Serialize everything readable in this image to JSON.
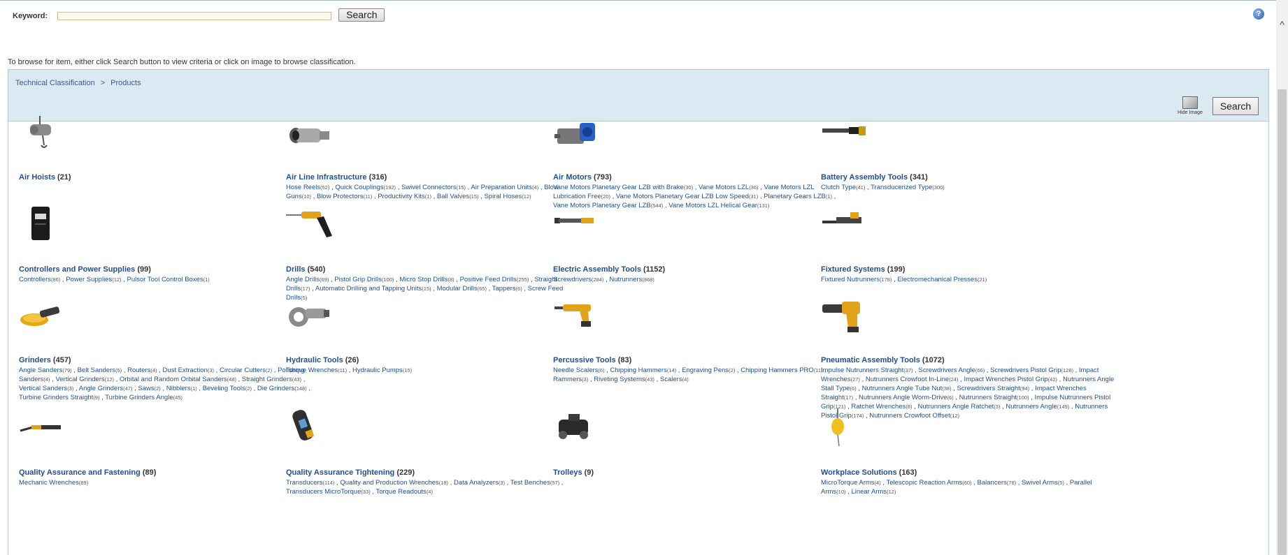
{
  "search": {
    "label": "Keyword:",
    "value": "",
    "button": "Search"
  },
  "instruction": "To browse for item, either click Search button to view criteria or click on image to browse classification.",
  "breadcrumb": {
    "root": "Technical Classification",
    "separator": ">",
    "current": "Products"
  },
  "panel": {
    "hide_image_label": "Hide Image",
    "search_button": "Search"
  },
  "categories": [
    {
      "name": "Air Hoists",
      "count": "(21)",
      "items": []
    },
    {
      "name": "Air Line Infrastructure",
      "count": "(316)",
      "items": [
        [
          "Hose Reels",
          "(52)"
        ],
        [
          "Quick Couplings",
          "(192)"
        ],
        [
          "Swivel Connectors",
          "(15)"
        ],
        [
          "Air Preparation Units",
          "(4)"
        ],
        [
          "Blow Guns",
          "(10)"
        ],
        [
          "Blow Protectors",
          "(11)"
        ],
        [
          "Productivity Kits",
          "(1)"
        ],
        [
          "Ball Valves",
          "(15)"
        ],
        [
          "Spiral Hoses",
          "(12)"
        ]
      ]
    },
    {
      "name": "Air Motors",
      "count": "(793)",
      "items": [
        [
          "Vane Motors Planetary Gear LZB with Brake",
          "(30)"
        ],
        [
          "Vane Motors LZL",
          "(36)"
        ],
        [
          "Vane Motors LZL Lubrication Free",
          "(20)"
        ],
        [
          "Vane Motors Planetary Gear LZB Low Speed",
          "(31)"
        ],
        [
          "Planetary Gears LZB",
          "(1)"
        ],
        [
          "Vane Motors Planetary Gear LZB",
          "(544)"
        ],
        [
          "Vane Motors LZL Helical Gear",
          "(131)"
        ]
      ]
    },
    {
      "name": "Battery Assembly Tools",
      "count": "(341)",
      "items": [
        [
          "Clutch Type",
          "(41)"
        ],
        [
          "Transducerized Type",
          "(300)"
        ]
      ]
    },
    {
      "name": "Controllers and Power Supplies",
      "count": "(99)",
      "items": [
        [
          "Controllers",
          "(86)"
        ],
        [
          "Power Supplies",
          "(12)"
        ],
        [
          "Pulsor Tool Control Boxes",
          "(1)"
        ]
      ]
    },
    {
      "name": "Drills",
      "count": "(540)",
      "items": [
        [
          "Angle Drills",
          "(69)"
        ],
        [
          "Pistol Grip Drills",
          "(100)"
        ],
        [
          "Micro Stop Drills",
          "(8)"
        ],
        [
          "Positive Feed Drills",
          "(255)"
        ],
        [
          "Straight Drills",
          "(17)"
        ],
        [
          "Automatic Drilling and Tapping Units",
          "(15)"
        ],
        [
          "Modular Drills",
          "(65)"
        ],
        [
          "Tappers",
          "(6)"
        ],
        [
          "Screw Feed Drills",
          "(5)"
        ]
      ]
    },
    {
      "name": "Electric Assembly Tools",
      "count": "(1152)",
      "items": [
        [
          "Screwdrivers",
          "(284)"
        ],
        [
          "Nutrunners",
          "(868)"
        ]
      ]
    },
    {
      "name": "Fixtured Systems",
      "count": "(199)",
      "items": [
        [
          "Fixtured Nutrunners",
          "(178)"
        ],
        [
          "Electromechanical Presses",
          "(21)"
        ]
      ]
    },
    {
      "name": "Grinders",
      "count": "(457)",
      "items": [
        [
          "Angle Sanders",
          "(79)"
        ],
        [
          "Belt Sanders",
          "(5)"
        ],
        [
          "Routers",
          "(4)"
        ],
        [
          "Dust Extraction",
          "(3)"
        ],
        [
          "Circular Cutters",
          "(2)"
        ],
        [
          "Polishing Sanders",
          "(4)"
        ],
        [
          "Vertical Grinders",
          "(12)"
        ],
        [
          "Orbital and Random Orbital Sanders",
          "(48)"
        ],
        [
          "Straight Grinders",
          "(43)"
        ],
        [
          "Vertical Sanders",
          "(3)"
        ],
        [
          "Angle Grinders",
          "(47)"
        ],
        [
          "Saws",
          "(2)"
        ],
        [
          "Nibblers",
          "(1)"
        ],
        [
          "Beveling Tools",
          "(2)"
        ],
        [
          "Die Grinders",
          "(148)"
        ],
        [
          "Turbine Grinders Straight",
          "(9)"
        ],
        [
          "Turbine Grinders Angle",
          "(45)"
        ]
      ]
    },
    {
      "name": "Hydraulic Tools",
      "count": "(26)",
      "items": [
        [
          "Torque Wrenches",
          "(11)"
        ],
        [
          "Hydraulic Pumps",
          "(15)"
        ]
      ]
    },
    {
      "name": "Percussive Tools",
      "count": "(83)",
      "items": [
        [
          "Needle Scalers",
          "(6)"
        ],
        [
          "Chipping Hammers",
          "(14)"
        ],
        [
          "Engraving Pens",
          "(2)"
        ],
        [
          "Chipping Hammers PRO",
          "(11)"
        ],
        [
          "Rammers",
          "(3)"
        ],
        [
          "Riveting Systems",
          "(43)"
        ],
        [
          "Scalers",
          "(4)"
        ]
      ]
    },
    {
      "name": "Pneumatic Assembly Tools",
      "count": "(1072)",
      "items": [
        [
          "Impulse Nutrunners Straight",
          "(37)"
        ],
        [
          "Screwdrivers Angle",
          "(66)"
        ],
        [
          "Screwdrivers Pistol Grip",
          "(128)"
        ],
        [
          "Impact Wrenches",
          "(27)"
        ],
        [
          "Nutrunners Crowfoot In-Line",
          "(24)"
        ],
        [
          "Impact Wrenches Pistol Grip",
          "(42)"
        ],
        [
          "Nutrunners Angle Stall Type",
          "(6)"
        ],
        [
          "Nutrunners Angle Tube Nut",
          "(38)"
        ],
        [
          "Screwdrivers Straight",
          "(94)"
        ],
        [
          "Impact Wrenches Straight",
          "(17)"
        ],
        [
          "Nutrunners Angle Worm-Drive",
          "(6)"
        ],
        [
          "Nutrunners Straight",
          "(100)"
        ],
        [
          "Impulse Nutrunners Pistol Grip",
          "(121)"
        ],
        [
          "Ratchet Wrenches",
          "(8)"
        ],
        [
          "Nutrunners Angle Ratchet",
          "(3)"
        ],
        [
          "Nutrunners Angle",
          "(149)"
        ],
        [
          "Nutrunners Pistol Grip",
          "(174)"
        ],
        [
          "Nutrunners Crowfoot Offset",
          "(12)"
        ]
      ]
    },
    {
      "name": "Quality Assurance and Fastening",
      "count": "(89)",
      "items": [
        [
          "Mechanic Wrenches",
          "(89)"
        ]
      ]
    },
    {
      "name": "Quality Assurance Tightening",
      "count": "(229)",
      "items": [
        [
          "Transducers",
          "(114)"
        ],
        [
          "Quality and Production Wrenches",
          "(18)"
        ],
        [
          "Data Analyzers",
          "(3)"
        ],
        [
          "Test Benches",
          "(57)"
        ],
        [
          "Transducers MicroTorque",
          "(33)"
        ],
        [
          "Torque Readouts",
          "(4)"
        ]
      ]
    },
    {
      "name": "Trolleys",
      "count": "(9)",
      "items": []
    },
    {
      "name": "Workplace Solutions",
      "count": "(163)",
      "items": [
        [
          "MicroTorque Arms",
          "(4)"
        ],
        [
          "Telescopic Reaction Arms",
          "(60)"
        ],
        [
          "Balancers",
          "(78)"
        ],
        [
          "Swivel Arms",
          "(5)"
        ],
        [
          "Parallel Arms",
          "(10)"
        ],
        [
          "Linear Arms",
          "(12)"
        ]
      ]
    }
  ],
  "icons": [
    "air-hoist-icon",
    "air-line-coupling-icon",
    "air-motor-icon",
    "battery-tool-icon",
    "controller-icon",
    "drill-icon",
    "electric-nutrunner-icon",
    "fixtured-system-icon",
    "grinder-icon",
    "hydraulic-wrench-icon",
    "percussive-hammer-icon",
    "pneumatic-impact-wrench-icon",
    "mechanic-wrench-icon",
    "torque-analyzer-icon",
    "trolley-icon",
    "balancer-icon"
  ]
}
